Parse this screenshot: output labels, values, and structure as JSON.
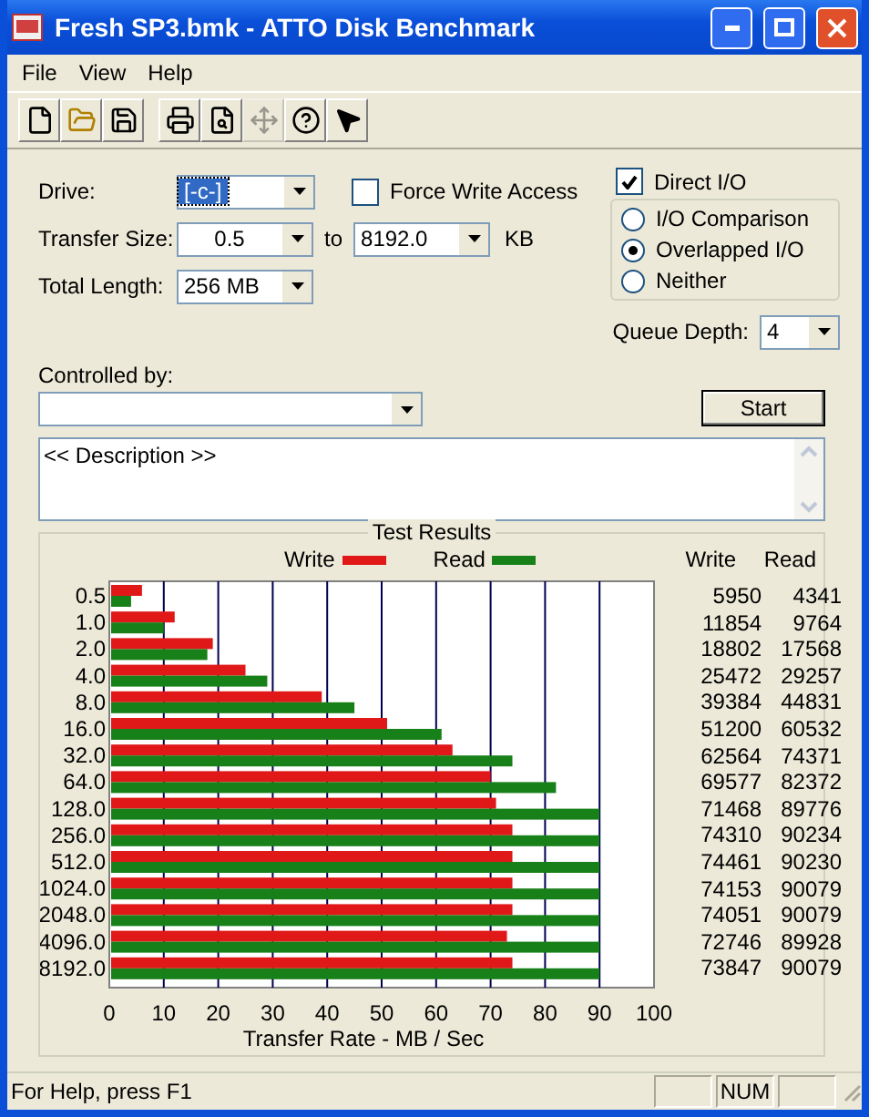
{
  "window": {
    "title": "Fresh SP3.bmk - ATTO Disk Benchmark"
  },
  "menu": [
    "File",
    "View",
    "Help"
  ],
  "toolbar": [
    {
      "kind": "new",
      "disabled": false
    },
    {
      "kind": "open",
      "disabled": false
    },
    {
      "kind": "save",
      "disabled": false
    },
    {
      "kind": "print",
      "disabled": false
    },
    {
      "kind": "preview",
      "disabled": false
    },
    {
      "kind": "move",
      "disabled": true
    },
    {
      "kind": "help",
      "disabled": false
    },
    {
      "kind": "context-help",
      "disabled": false
    }
  ],
  "drive": {
    "label": "Drive:",
    "value": "[-c-]"
  },
  "force_write_access": {
    "label": "Force Write Access",
    "checked": false
  },
  "transfer_size": {
    "label": "Transfer Size:",
    "from": "0.5",
    "to_label": "to",
    "to": "8192.0",
    "unit": "KB"
  },
  "total_length": {
    "label": "Total Length:",
    "value": "256 MB"
  },
  "direct_io": {
    "label": "Direct I/O",
    "checked": true
  },
  "io_modes": [
    {
      "label": "I/O Comparison",
      "selected": false
    },
    {
      "label": "Overlapped I/O",
      "selected": true
    },
    {
      "label": "Neither",
      "selected": false
    }
  ],
  "queue_depth": {
    "label": "Queue Depth:",
    "value": "4"
  },
  "controlled_by": {
    "label": "Controlled by:"
  },
  "start_button": "Start",
  "description": "<< Description >>",
  "test_results": {
    "title": "Test Results",
    "columns": [
      "Write",
      "Read"
    ],
    "rows": [
      {
        "write": "5950",
        "read": "4341"
      },
      {
        "write": "11854",
        "read": "9764"
      },
      {
        "write": "18802",
        "read": "17568"
      },
      {
        "write": "25472",
        "read": "29257"
      },
      {
        "write": "39384",
        "read": "44831"
      },
      {
        "write": "51200",
        "read": "60532"
      },
      {
        "write": "62564",
        "read": "74371"
      },
      {
        "write": "69577",
        "read": "82372"
      },
      {
        "write": "71468",
        "read": "89776"
      },
      {
        "write": "74310",
        "read": "90234"
      },
      {
        "write": "74461",
        "read": "90230"
      },
      {
        "write": "74153",
        "read": "90079"
      },
      {
        "write": "74051",
        "read": "90079"
      },
      {
        "write": "72746",
        "read": "89928"
      },
      {
        "write": "73847",
        "read": "90079"
      }
    ],
    "chart_data": {
      "type": "bar",
      "orientation": "horizontal",
      "xlabel": "Transfer Rate - MB / Sec",
      "categories": [
        "0.5",
        "1.0",
        "2.0",
        "4.0",
        "8.0",
        "16.0",
        "32.0",
        "64.0",
        "128.0",
        "256.0",
        "512.0",
        "1024.0",
        "2048.0",
        "4096.0",
        "8192.0"
      ],
      "series": [
        {
          "name": "Write",
          "color": "#e01818",
          "values": [
            6,
            12,
            19,
            25,
            39,
            51,
            63,
            70,
            71,
            74,
            74,
            74,
            74,
            73,
            74
          ]
        },
        {
          "name": "Read",
          "color": "#188018",
          "values": [
            4,
            10,
            18,
            29,
            45,
            61,
            74,
            82,
            90,
            90,
            90,
            90,
            90,
            90,
            90
          ]
        }
      ],
      "xlim": [
        0,
        100
      ],
      "grid": true,
      "xticks": [
        0,
        10,
        20,
        30,
        40,
        50,
        60,
        70,
        80,
        90,
        100
      ]
    }
  },
  "status_bar": {
    "text": "For Help, press F1",
    "indicators": [
      "NUM"
    ]
  }
}
